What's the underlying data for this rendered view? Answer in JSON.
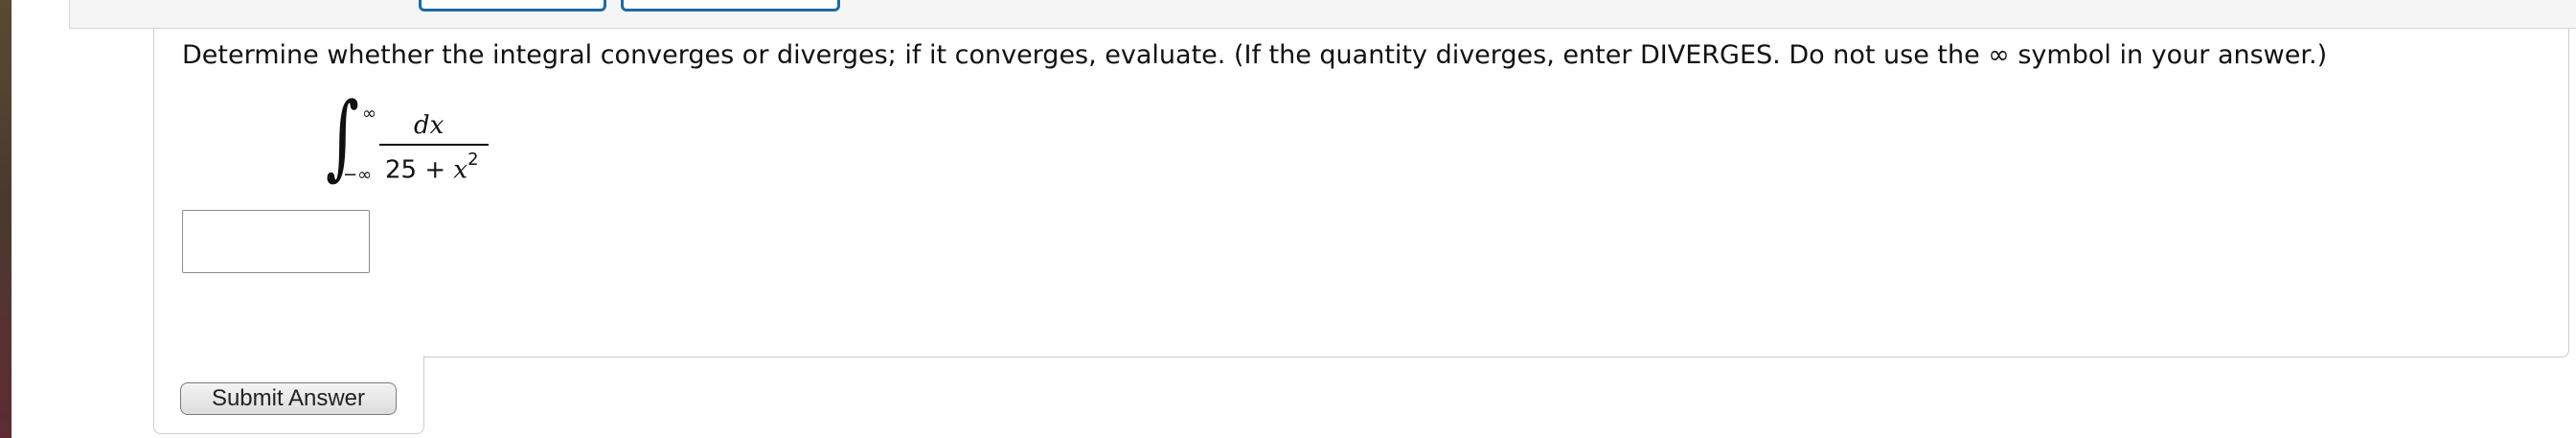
{
  "question": {
    "prompt": "Determine whether the integral converges or diverges; if it converges, evaluate. (If the quantity diverges, enter DIVERGES. Do not use the ∞ symbol in your answer.)"
  },
  "integral": {
    "sign": "∫",
    "upper_limit": "∞",
    "lower_limit": "−∞",
    "numerator": "dx",
    "denominator_const": "25 + ",
    "denominator_var": "x",
    "denominator_exponent": "2"
  },
  "answer": {
    "value": "",
    "placeholder": ""
  },
  "submit": {
    "label": "Submit Answer"
  },
  "colors": {
    "tab_button_border": "#1f6aa5",
    "side_strip_top": "#5a4a32",
    "side_strip_bottom": "#5e2b34"
  }
}
